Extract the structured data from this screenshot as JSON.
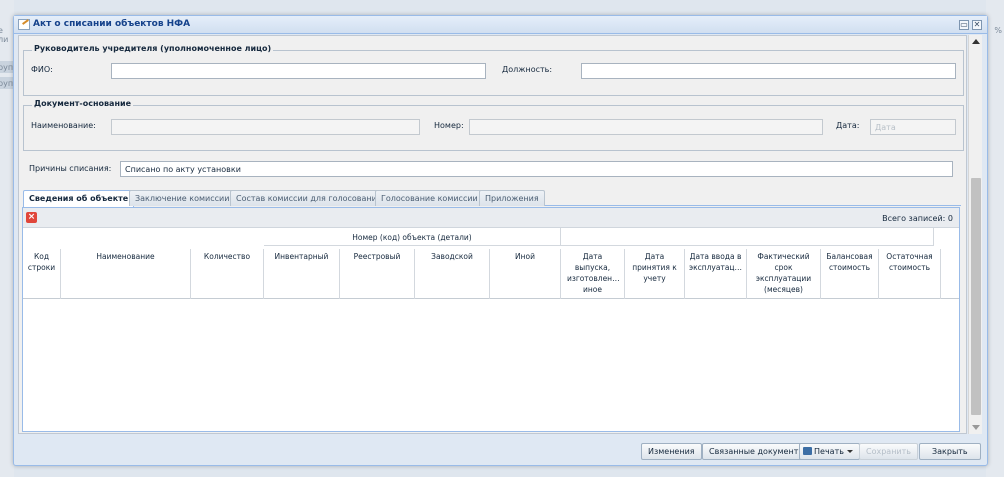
{
  "background": {
    "left_fragments": [
      "е ли",
      "руп",
      "руп"
    ],
    "right_fragment": "%"
  },
  "window": {
    "title": "Акт о списании объектов НФА"
  },
  "head_section": {
    "legend": "Руководитель учредителя (уполномоченное лицо)",
    "fio_label": "ФИО:",
    "fio_value": "",
    "position_label": "Должность:",
    "position_value": ""
  },
  "basis_section": {
    "legend": "Документ-основание",
    "name_label": "Наименование:",
    "name_value": "",
    "number_label": "Номер:",
    "number_value": "",
    "date_label": "Дата:",
    "date_placeholder": "Дата"
  },
  "reason": {
    "label": "Причины списания:",
    "value": "Списано по акту установки"
  },
  "tabs": [
    {
      "label": "Сведения об объекте",
      "active": true
    },
    {
      "label": "Заключение комиссии",
      "active": false
    },
    {
      "label": "Состав комиссии для голосования",
      "active": false
    },
    {
      "label": "Голосование комиссии",
      "active": false
    },
    {
      "label": "Приложения",
      "active": false
    }
  ],
  "grid": {
    "total_label": "Всего записей: 0",
    "group_header": "Номер (код) объекта (детали)",
    "columns": [
      "Код строки",
      "Наименование",
      "Количество",
      "Инвентарный",
      "Реестровый",
      "Заводской",
      "Иной",
      "Дата выпуска, изготовлен… иное",
      "Дата принятия к учету",
      "Дата ввода в эксплуатац…",
      "Фактический срок эксплуатации (месяцев)",
      "Балансовая стоимость",
      "Остаточная стоимость"
    ],
    "rows": []
  },
  "footer": {
    "changes": "Изменения",
    "related_docs": "Связанные документы",
    "print": "Печать",
    "save": "Сохранить",
    "close": "Закрыть"
  }
}
